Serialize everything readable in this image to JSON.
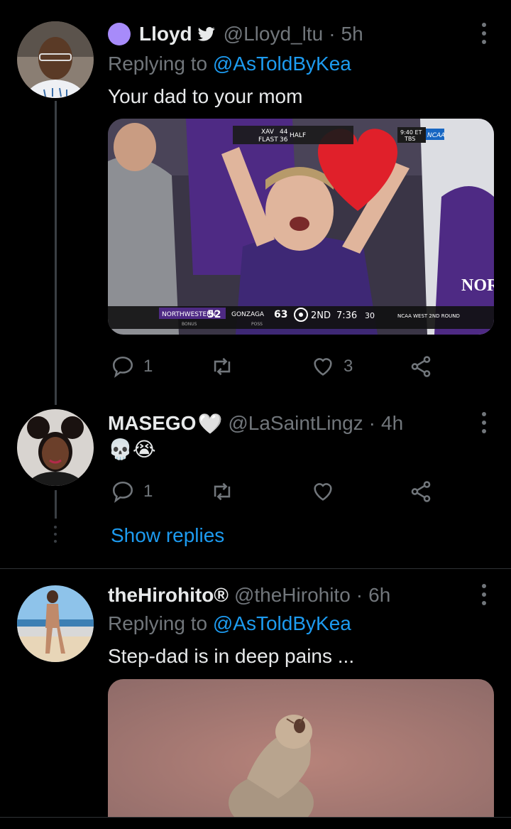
{
  "tweets": [
    {
      "name": "Lloyd",
      "verified_badge": "purple-circle",
      "icon_after_name": "bird-icon",
      "handle": "@Lloyd_ltu",
      "separator": "·",
      "time": "5h",
      "replying_prefix": "Replying to",
      "replying_to": "@AsToldByKea",
      "text": "Your dad to your mom",
      "media": {
        "scoreboard": {
          "team1": "NORTHWESTERN",
          "score1": "52",
          "team2": "GONZAGA",
          "score2": "63",
          "period": "2ND",
          "clock": "7:36",
          "shot": "30",
          "round": "NCAA WEST 2ND ROUND",
          "bonus": "BONUS",
          "poss": "POSS"
        },
        "ticker": {
          "team_a": "XAV",
          "score_a": "44",
          "half": "HALF",
          "team_b": "FLAST",
          "score_b": "36",
          "time": "9:40 ET",
          "network": "TBS",
          "league": "NCAA"
        },
        "jersey_text": "NORT"
      },
      "actions": {
        "replies": "1",
        "retweets": "",
        "likes": "3"
      }
    },
    {
      "name": "MASEGO",
      "name_emoji": "🤍",
      "handle": "@LaSaintLingz",
      "separator": "·",
      "time": "4h",
      "text": "💀😭",
      "actions": {
        "replies": "1",
        "retweets": "",
        "likes": ""
      }
    },
    {
      "name": "theHirohito®",
      "handle": "@theHirohito",
      "separator": "·",
      "time": "6h",
      "replying_prefix": "Replying to",
      "replying_to": "@AsToldByKea",
      "text": "Step-dad is in deep pains ..."
    }
  ],
  "show_replies": "Show replies",
  "colors": {
    "accent": "#1d9bf0",
    "muted": "#71767b",
    "background": "#000000",
    "badge": "#a78bfa"
  }
}
